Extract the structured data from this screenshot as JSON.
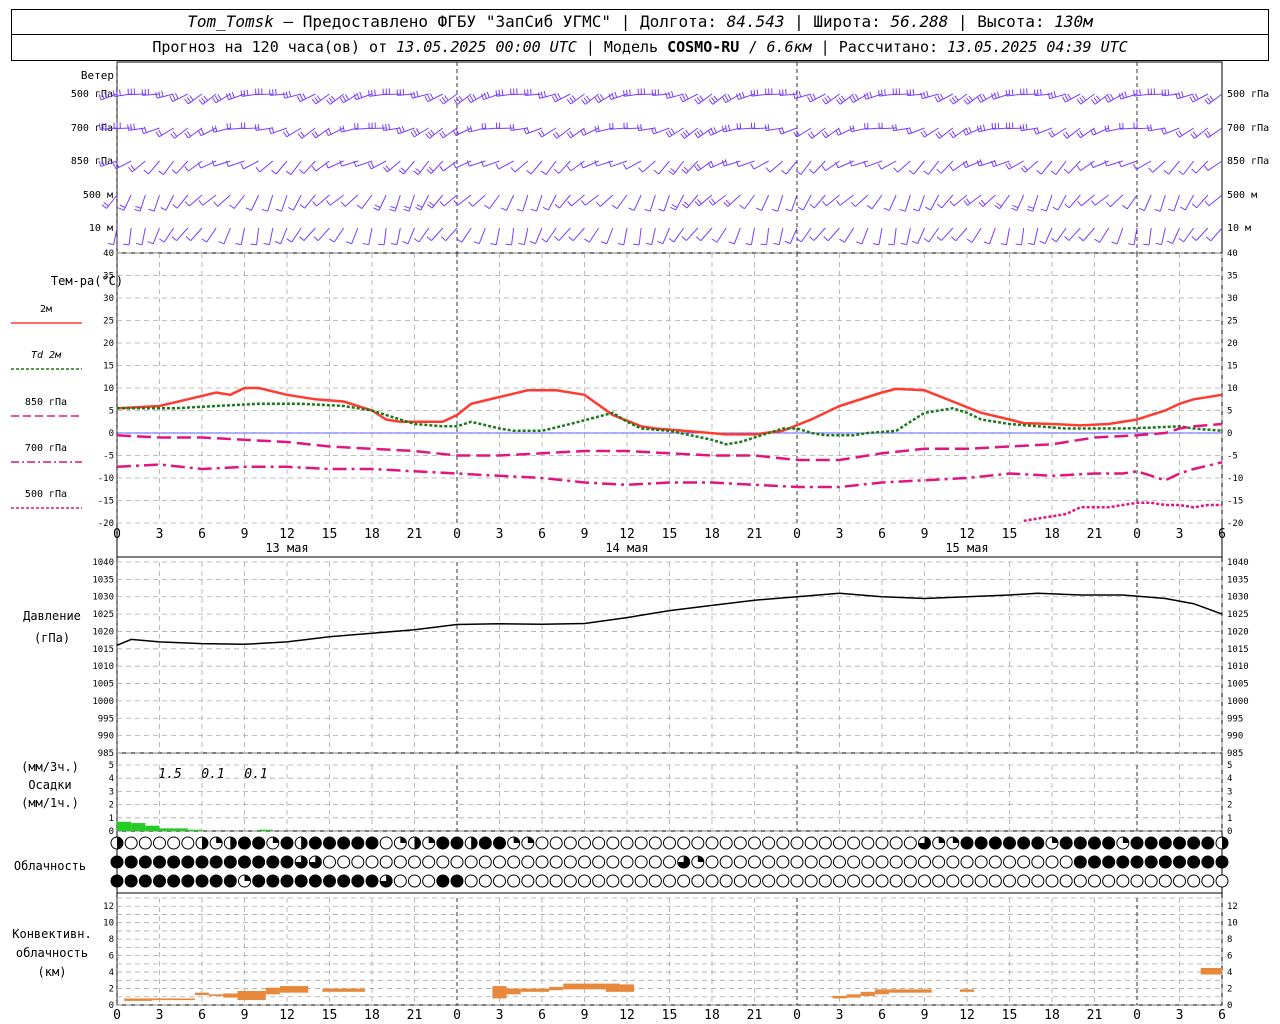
{
  "header": {
    "station": "Tom_Tomsk",
    "dash": " – ",
    "provider": "Предоставлено ФГБУ \"ЗапСиб УГМС\"",
    "lon_label": "Долгота:",
    "lon": "84.543",
    "lat_label": "Широта:",
    "lat": "56.288",
    "alt_label": "Высота:",
    "alt": "130м",
    "forecast_prefix": "Прогноз на 120 часа(ов) от",
    "forecast_start": "13.05.2025 00:00 UTC",
    "model_label": "Модель",
    "model": "COSMO-RU",
    "model_res": "6.6км",
    "computed_label": "Рассчитано:",
    "computed": "13.05.2025 04:39 UTC",
    "sep": "|"
  },
  "time_axis": {
    "hour_labels": [
      "0",
      "3",
      "6",
      "9",
      "12",
      "15",
      "18",
      "21",
      "0",
      "3",
      "6",
      "9",
      "12",
      "15",
      "18",
      "21",
      "0",
      "3",
      "6",
      "9",
      "12",
      "15",
      "18",
      "21",
      "0",
      "3",
      "6"
    ],
    "day_labels": [
      "13 мая",
      "14 мая",
      "15 мая"
    ]
  },
  "wind": {
    "title": "Ветер",
    "levels": [
      "500 гПа",
      "700 гПа",
      "850 гПа",
      "500 м",
      "10  м"
    ]
  },
  "temperature": {
    "title": "Тем-ра(°C)",
    "legend": [
      {
        "label": "2м",
        "color": "#ff3b30",
        "style": "solid"
      },
      {
        "label": "Td 2м",
        "color": "#1a7a1a",
        "style": "dotted"
      },
      {
        "label": "850 гПа",
        "color": "#e0157f",
        "style": "dashed"
      },
      {
        "label": "700 гПа",
        "color": "#e0157f",
        "style": "dashdot"
      },
      {
        "label": "500 гПа",
        "color": "#e0157f",
        "style": "dotted"
      }
    ],
    "y_ticks": [
      "40",
      "35",
      "30",
      "25",
      "20",
      "15",
      "10",
      "5",
      "0",
      "-5",
      "-10",
      "-15",
      "-20"
    ]
  },
  "pressure": {
    "title": "Давление",
    "unit": "(гПа)",
    "y_ticks": [
      "1040",
      "1035",
      "1030",
      "1025",
      "1020",
      "1015",
      "1010",
      "1005",
      "1000",
      "995",
      "990",
      "985"
    ]
  },
  "precip": {
    "unit3": "(мм/3ч.)",
    "title": "Осадки",
    "unit1": "(мм/1ч.)",
    "y_ticks": [
      "5",
      "4",
      "3",
      "2",
      "1",
      "0"
    ],
    "totals": [
      "1.5",
      "0.1",
      "0.1"
    ]
  },
  "clouds": {
    "title": "Облачность"
  },
  "convective": {
    "title1": "Конвективн.",
    "title2": "облачность",
    "unit": "(км)",
    "y_ticks": [
      "12",
      "10",
      "8",
      "6",
      "4",
      "2",
      "0"
    ]
  },
  "chart_data": {
    "type": "meteogram",
    "x_unit": "hours from 13.05.2025 00:00 UTC",
    "x_range": [
      0,
      78
    ],
    "temperature_2m": {
      "x": [
        0,
        3,
        5,
        7,
        8,
        9,
        10,
        12,
        14,
        16,
        18,
        19,
        20,
        21,
        22,
        23,
        24,
        25,
        27,
        29,
        31,
        33,
        35,
        37,
        38,
        40,
        43,
        45,
        47,
        49,
        51,
        52,
        53,
        54,
        55,
        57,
        59,
        61,
        63,
        64,
        66,
        68,
        70,
        72,
        74,
        75,
        76,
        78
      ],
      "y": [
        5.5,
        6,
        7.5,
        9,
        8.5,
        10,
        10,
        8.5,
        7.5,
        7,
        5,
        3,
        2.5,
        2.5,
        2.5,
        2.5,
        4,
        6.5,
        8,
        9.5,
        9.5,
        8.5,
        4,
        1.5,
        1,
        0.5,
        -0.3,
        -0.3,
        0.5,
        3,
        6,
        7,
        8,
        9,
        9.8,
        9.5,
        7,
        4.5,
        3,
        2.2,
        2,
        1.7,
        2,
        3,
        5,
        6.5,
        7.5,
        8.5
      ]
    },
    "dewpoint_2m": {
      "x": [
        0,
        4,
        7,
        10,
        13,
        16,
        18,
        19,
        21,
        23,
        24,
        25,
        27,
        28,
        30,
        32,
        35,
        36,
        37,
        39,
        42,
        43,
        44,
        46,
        47,
        48,
        49,
        50,
        52,
        53,
        55,
        57,
        59,
        60,
        61,
        63,
        65,
        67,
        69,
        71,
        73,
        75,
        76,
        78
      ],
      "y": [
        5.5,
        5.5,
        6,
        6.5,
        6.5,
        6,
        5,
        4,
        2,
        1.5,
        1.5,
        2.5,
        1,
        0.5,
        0.5,
        2,
        4.5,
        2.5,
        1,
        0.5,
        -1.5,
        -2.5,
        -2,
        0,
        1,
        1,
        0,
        -0.5,
        -0.5,
        0,
        0.5,
        4.5,
        5.5,
        4.5,
        3,
        2,
        1.5,
        1,
        1,
        1,
        1.2,
        1.5,
        1,
        0.5
      ]
    },
    "t850": {
      "x": [
        0,
        3,
        6,
        9,
        12,
        15,
        18,
        21,
        24,
        27,
        30,
        33,
        36,
        39,
        42,
        45,
        48,
        51,
        54,
        57,
        60,
        63,
        66,
        69,
        72,
        74,
        75,
        76,
        78
      ],
      "y": [
        -0.5,
        -1,
        -1,
        -1.5,
        -2,
        -3,
        -3.5,
        -4,
        -5,
        -5,
        -4.5,
        -4,
        -4,
        -4.5,
        -5,
        -5,
        -6,
        -6,
        -4.5,
        -3.5,
        -3.5,
        -3,
        -2.5,
        -1,
        -0.5,
        0,
        1,
        1.5,
        2
      ]
    },
    "t700": {
      "x": [
        0,
        3,
        6,
        9,
        12,
        15,
        18,
        21,
        24,
        27,
        30,
        33,
        36,
        39,
        42,
        45,
        48,
        51,
        54,
        57,
        60,
        63,
        66,
        69,
        71,
        72,
        73,
        74,
        75,
        76,
        78
      ],
      "y": [
        -7.5,
        -7,
        -8,
        -7.5,
        -7.5,
        -8,
        -8,
        -8.5,
        -9,
        -9.5,
        -10,
        -11,
        -11.5,
        -11,
        -11,
        -11.5,
        -12,
        -12,
        -11,
        -10.5,
        -10,
        -9,
        -9.5,
        -9,
        -9,
        -8.5,
        -9.5,
        -10.5,
        -9,
        -8,
        -6.5
      ]
    },
    "t500": {
      "x": [
        64,
        66,
        67,
        68,
        69,
        70,
        71,
        72,
        73,
        74,
        75,
        76,
        77,
        78
      ],
      "y": [
        -19.5,
        -18.5,
        -18,
        -16.5,
        -16.5,
        -16.5,
        -16,
        -15.5,
        -15.5,
        -16,
        -16,
        -16.5,
        -16,
        -16
      ]
    },
    "pressure": {
      "x": [
        0,
        1,
        3,
        6,
        9,
        12,
        15,
        18,
        21,
        24,
        27,
        30,
        33,
        36,
        39,
        42,
        45,
        48,
        51,
        54,
        57,
        60,
        63,
        65,
        68,
        71,
        74,
        76,
        78
      ],
      "y": [
        1016,
        1017.7,
        1017,
        1016.5,
        1016.3,
        1017,
        1018.5,
        1019.5,
        1020.5,
        1022,
        1022.2,
        1022.1,
        1022.3,
        1024,
        1026,
        1027.5,
        1029,
        1030,
        1031,
        1030,
        1029.5,
        1030,
        1030.5,
        1031,
        1030.5,
        1030.5,
        1029.5,
        1028,
        1025
      ]
    },
    "precip_mm_per_hour": {
      "x": [
        0,
        1,
        2,
        3,
        4,
        5,
        6,
        7,
        8,
        9,
        10,
        11,
        12
      ],
      "y": [
        0.7,
        0.6,
        0.4,
        0.2,
        0.2,
        0.1,
        0,
        0,
        0,
        0,
        0.1,
        0,
        0
      ]
    },
    "convective_cloud_km": [
      {
        "x0": 0.5,
        "x1": 2.5,
        "lo": 0.5,
        "hi": 0.8
      },
      {
        "x0": 2.5,
        "x1": 5.5,
        "lo": 0.6,
        "hi": 0.8
      },
      {
        "x0": 5.5,
        "x1": 6.5,
        "lo": 1.2,
        "hi": 1.5
      },
      {
        "x0": 6.5,
        "x1": 7.5,
        "lo": 1.1,
        "hi": 1.3
      },
      {
        "x0": 7.5,
        "x1": 8.5,
        "lo": 0.9,
        "hi": 1.4
      },
      {
        "x0": 8.5,
        "x1": 10.5,
        "lo": 0.6,
        "hi": 1.7
      },
      {
        "x0": 10.5,
        "x1": 11.5,
        "lo": 1.3,
        "hi": 2.1
      },
      {
        "x0": 11.5,
        "x1": 13.5,
        "lo": 1.5,
        "hi": 2.3
      },
      {
        "x0": 14.5,
        "x1": 17.5,
        "lo": 1.6,
        "hi": 2.0
      },
      {
        "x0": 26.5,
        "x1": 27.5,
        "lo": 0.8,
        "hi": 2.3
      },
      {
        "x0": 27.5,
        "x1": 28.5,
        "lo": 1.3,
        "hi": 2.0
      },
      {
        "x0": 28.5,
        "x1": 30.5,
        "lo": 1.6,
        "hi": 2.0
      },
      {
        "x0": 30.5,
        "x1": 31.5,
        "lo": 1.8,
        "hi": 2.2
      },
      {
        "x0": 31.5,
        "x1": 34.5,
        "lo": 1.9,
        "hi": 2.6
      },
      {
        "x0": 34.5,
        "x1": 35.5,
        "lo": 1.6,
        "hi": 2.6
      },
      {
        "x0": 35.5,
        "x1": 36.5,
        "lo": 1.6,
        "hi": 2.5
      },
      {
        "x0": 50.5,
        "x1": 51.5,
        "lo": 0.8,
        "hi": 1.1
      },
      {
        "x0": 51.5,
        "x1": 52.5,
        "lo": 0.9,
        "hi": 1.3
      },
      {
        "x0": 52.5,
        "x1": 53.5,
        "lo": 1.1,
        "hi": 1.6
      },
      {
        "x0": 53.5,
        "x1": 54.5,
        "lo": 1.3,
        "hi": 1.9
      },
      {
        "x0": 54.5,
        "x1": 57.5,
        "lo": 1.5,
        "hi": 1.9
      },
      {
        "x0": 59.5,
        "x1": 60.5,
        "lo": 1.6,
        "hi": 1.9
      },
      {
        "x0": 76.5,
        "x1": 78,
        "lo": 3.7,
        "hi": 4.5
      }
    ],
    "cloud_rows": {
      "description": "cover per hour, 0=clear 4=overcast, rows top/middle/bottom",
      "row1": [
        2,
        0,
        0,
        0,
        0,
        0,
        2,
        1,
        2,
        4,
        4,
        1,
        4,
        2,
        4,
        4,
        4,
        4,
        4,
        0,
        1,
        2,
        1,
        4,
        4,
        2,
        4,
        4,
        1,
        1,
        0,
        0,
        0,
        0,
        0,
        0,
        0,
        0,
        0,
        0,
        0,
        0,
        0,
        0,
        0,
        0,
        0,
        0,
        0,
        0,
        0,
        0,
        0,
        0,
        0,
        0,
        0,
        3,
        1,
        1,
        4,
        4,
        4,
        4,
        4,
        4,
        1,
        4,
        4,
        4,
        4,
        1,
        4,
        4,
        4,
        4,
        4,
        4,
        2
      ],
      "row2": [
        4,
        4,
        4,
        4,
        4,
        4,
        4,
        4,
        4,
        4,
        4,
        4,
        4,
        3,
        3,
        0,
        0,
        0,
        0,
        0,
        0,
        0,
        0,
        0,
        0,
        0,
        0,
        0,
        0,
        0,
        0,
        0,
        0,
        0,
        0,
        0,
        0,
        0,
        0,
        0,
        3,
        1,
        0,
        0,
        0,
        0,
        0,
        0,
        0,
        0,
        0,
        0,
        0,
        0,
        0,
        0,
        0,
        0,
        0,
        0,
        0,
        0,
        0,
        0,
        0,
        0,
        0,
        0,
        4,
        4,
        4,
        4,
        4,
        4,
        4,
        4,
        4,
        4,
        4
      ],
      "row3": [
        4,
        4,
        4,
        4,
        4,
        4,
        4,
        4,
        4,
        1,
        4,
        4,
        4,
        4,
        4,
        4,
        4,
        4,
        4,
        3,
        0,
        0,
        0,
        4,
        4,
        0,
        0,
        0,
        0,
        0,
        0,
        0,
        0,
        0,
        0,
        0,
        0,
        0,
        0,
        0,
        0,
        0,
        0,
        0,
        0,
        0,
        0,
        0,
        0,
        0,
        0,
        0,
        0,
        0,
        0,
        0,
        0,
        0,
        0,
        0,
        0,
        0,
        0,
        0,
        0,
        0,
        0,
        0,
        0,
        0,
        0,
        0,
        0,
        0,
        0,
        0,
        0,
        0,
        0
      ]
    }
  }
}
